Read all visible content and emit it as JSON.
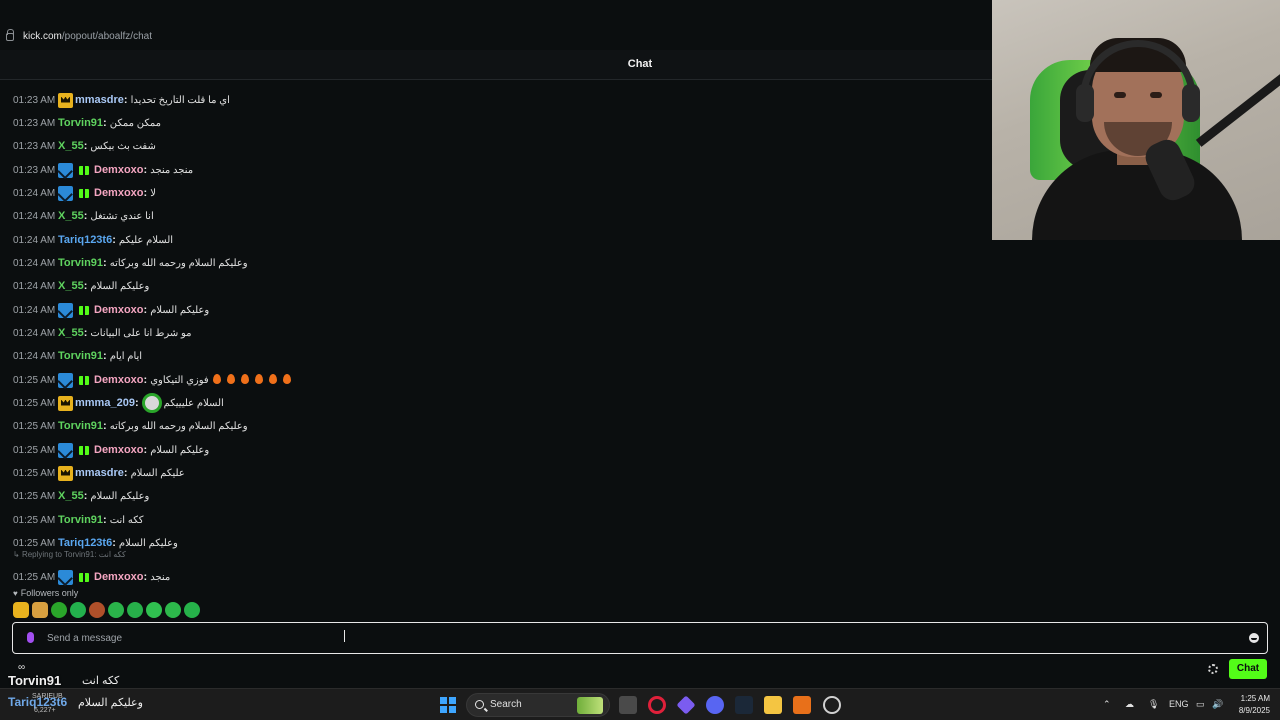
{
  "browser": {
    "url_host": "kick.com",
    "url_path": "/popout/aboalfz/chat"
  },
  "chat": {
    "title": "Chat",
    "messages": [
      {
        "time": "01:23 AM",
        "user": "mmasdre",
        "color": "#a9c8f5",
        "badges": [
          "crown"
        ],
        "text": "اي ما قلت التاريخ تحديدا"
      },
      {
        "time": "01:23 AM",
        "user": "Torvin91",
        "color": "#5fd35f",
        "badges": [],
        "text": "ممكن ممكن"
      },
      {
        "time": "01:23 AM",
        "user": "X_55",
        "color": "#5fd35f",
        "badges": [],
        "text": "شفت بث بيكس"
      },
      {
        "time": "01:23 AM",
        "user": "Demxoxo",
        "color": "#f5a6c2",
        "badges": [
          "mod",
          "gift"
        ],
        "text": "منجد منجد"
      },
      {
        "time": "01:24 AM",
        "user": "Demxoxo",
        "color": "#f5a6c2",
        "badges": [
          "mod",
          "gift"
        ],
        "text": "لا"
      },
      {
        "time": "01:24 AM",
        "user": "X_55",
        "color": "#5fd35f",
        "badges": [],
        "text": "انا عندي تشتغل"
      },
      {
        "time": "01:24 AM",
        "user": "Tariq123t6",
        "color": "#5aa7f0",
        "badges": [],
        "text": "السلام عليكم"
      },
      {
        "time": "01:24 AM",
        "user": "Torvin91",
        "color": "#5fd35f",
        "badges": [],
        "text": "وعليكم السلام ورحمه الله وبركاته"
      },
      {
        "time": "01:24 AM",
        "user": "X_55",
        "color": "#5fd35f",
        "badges": [],
        "text": "وعليكم السلام"
      },
      {
        "time": "01:24 AM",
        "user": "Demxoxo",
        "color": "#f5a6c2",
        "badges": [
          "mod",
          "gift"
        ],
        "text": "وعليكم السلام"
      },
      {
        "time": "01:24 AM",
        "user": "X_55",
        "color": "#5fd35f",
        "badges": [],
        "text": "مو شرط انا على البيانات"
      },
      {
        "time": "01:24 AM",
        "user": "Torvin91",
        "color": "#5fd35f",
        "badges": [],
        "text": "ايام ايام"
      },
      {
        "time": "01:25 AM",
        "user": "Demxoxo",
        "color": "#f5a6c2",
        "badges": [
          "mod",
          "gift"
        ],
        "text": "فوزي التيكاوي",
        "fire_count": 6
      },
      {
        "time": "01:25 AM",
        "user": "mmma_209",
        "color": "#a9c8f5",
        "badges": [
          "crown"
        ],
        "text": "السلام عليييكم",
        "emote": "green-face-emote"
      },
      {
        "time": "01:25 AM",
        "user": "Torvin91",
        "color": "#5fd35f",
        "badges": [],
        "text": "وعليكم السلام ورحمه الله وبركاته"
      },
      {
        "time": "01:25 AM",
        "user": "Demxoxo",
        "color": "#f5a6c2",
        "badges": [
          "mod",
          "gift"
        ],
        "text": "وعليكم السلام"
      },
      {
        "time": "01:25 AM",
        "user": "mmasdre",
        "color": "#a9c8f5",
        "badges": [
          "crown"
        ],
        "text": "عليكم السلام"
      },
      {
        "time": "01:25 AM",
        "user": "X_55",
        "color": "#5fd35f",
        "badges": [],
        "text": "وعليكم السلام"
      },
      {
        "time": "01:25 AM",
        "user": "Torvin91",
        "color": "#5fd35f",
        "badges": [],
        "text": "ككه انت"
      },
      {
        "time": "01:25 AM",
        "user": "Tariq123t6",
        "color": "#5aa7f0",
        "badges": [],
        "text": "وعليكم السلام"
      },
      {
        "time": "01:25 AM",
        "user": "Demxoxo",
        "color": "#f5a6c2",
        "badges": [
          "mod",
          "gift"
        ],
        "text": "منجد"
      }
    ],
    "reply_note": "Replying to Torvin91: ككه انت",
    "followers_only": "Followers only",
    "emote_colors": [
      "#e8b21e",
      "#d8a040",
      "#2aa52a",
      "#23b14d",
      "#b0502a",
      "#2ab44a",
      "#27b04a",
      "#30c050",
      "#2db84b",
      "#26b24a"
    ],
    "input_placeholder": "Send a message",
    "send_label": "Chat"
  },
  "overlay": {
    "user": "Torvin91",
    "text": "ككه انت"
  },
  "taskbar": {
    "user": "Tariq123t6",
    "text": "وعليكم السلام",
    "sub_label": "SARIEUB",
    "count": "6,227+",
    "search_label": "Search",
    "lang": "ENG",
    "time": "1:25 AM",
    "date": "8/9/2025"
  }
}
